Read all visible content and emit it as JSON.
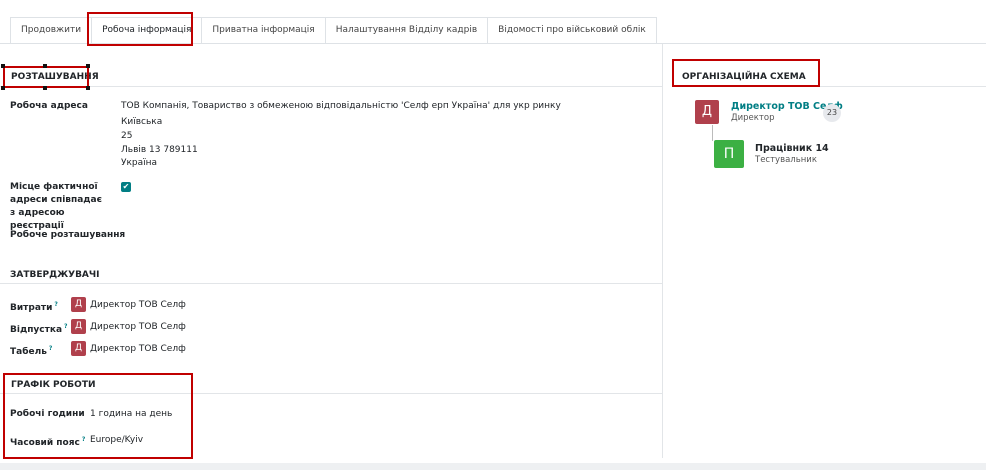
{
  "tabs": [
    {
      "label": "Продовжити"
    },
    {
      "label": "Робоча інформація"
    },
    {
      "label": "Приватна інформація"
    },
    {
      "label": "Налаштування Відділу кадрів"
    },
    {
      "label": "Відомості про військовий облік"
    }
  ],
  "location": {
    "title": "РОЗТАШУВАННЯ",
    "work_address_label": "Робоча адреса",
    "address_lines": [
      "ТОВ Компанія, Товариство з обмеженою відповідальністю 'Селф ерп Україна' для укр ринку",
      "Київська",
      "25",
      "Львів 13 789111",
      "Україна"
    ],
    "same_address_label": "Місце фактичної адреси співпадає з адресою реєстрації",
    "same_address_checked": true,
    "work_location_label": "Робоче розташування",
    "work_location_value": ""
  },
  "approvers": {
    "title": "ЗАТВЕРДЖУВАЧІ",
    "rows": [
      {
        "label": "Витрати",
        "help": "?",
        "avatar": "Д",
        "name": "Директор ТОВ Селф"
      },
      {
        "label": "Відпустка",
        "help": "?",
        "avatar": "Д",
        "name": "Директор ТОВ Селф"
      },
      {
        "label": "Табель",
        "help": "?",
        "avatar": "Д",
        "name": "Директор ТОВ Селф"
      }
    ]
  },
  "schedule": {
    "title": "ГРАФІК РОБОТИ",
    "hours_label": "Робочі години",
    "hours_value": "1 година на день",
    "tz_label": "Часовий пояс",
    "tz_help": "?",
    "tz_value": "Europe/Kyiv"
  },
  "org_chart": {
    "title": "ОРГАНІЗАЦІЙНА СХЕМА",
    "manager": {
      "avatar": "Д",
      "name": "Директор ТОВ Селф",
      "job": "Директор",
      "count": "23",
      "color": "#b0404c"
    },
    "employee": {
      "avatar": "П",
      "name": "Працівник 14",
      "job": "Тестувальник",
      "color": "#3cb043"
    }
  },
  "colors": {
    "accent": "#017e84",
    "highlight": "#c00000"
  }
}
